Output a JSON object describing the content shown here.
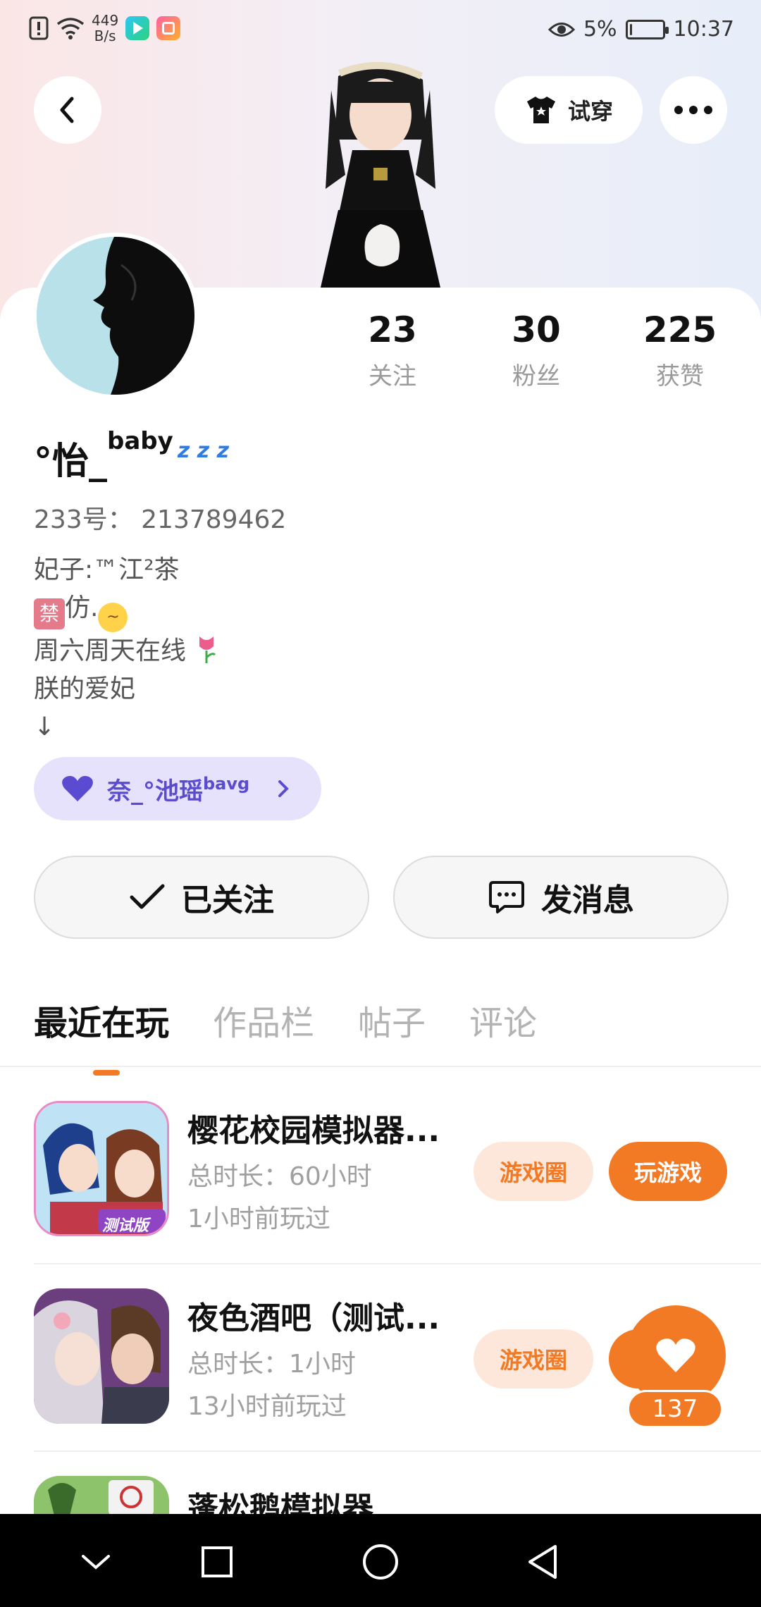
{
  "status_bar": {
    "net_speed_value": "449",
    "net_speed_unit": "B/s",
    "battery": "5%",
    "time": "10:37",
    "battery_level": 0.05
  },
  "header": {
    "try_on_label": "试穿"
  },
  "stats": [
    {
      "value": "23",
      "label": "关注"
    },
    {
      "value": "30",
      "label": "粉丝"
    },
    {
      "value": "225",
      "label": "获赞"
    }
  ],
  "profile": {
    "nickname_main": "°怡_",
    "nickname_sup": "baby",
    "nickname_zzz": "z z z",
    "id_line": "233号：  213789462",
    "bio": {
      "line1": "妃子:™江²茶",
      "line2_tag": "禁",
      "line2_text": "仿.",
      "line3": "周六周天在线",
      "line4": "朕的爱妃",
      "line5": "↓"
    },
    "couple_name": "奈_°池瑶",
    "couple_sup": "bavg"
  },
  "actions": {
    "follow_label": "已关注",
    "message_label": "发消息"
  },
  "tabs": [
    {
      "label": "最近在玩",
      "active": true
    },
    {
      "label": "作品栏",
      "active": false
    },
    {
      "label": "帖子",
      "active": false
    },
    {
      "label": "评论",
      "active": false
    }
  ],
  "games": [
    {
      "title": "樱花校园模拟器...",
      "duration": "总时长：60小时",
      "last_played": "1小时前玩过",
      "circle_label": "游戏圈",
      "play_label": "玩游戏",
      "icon_badge": "测试版"
    },
    {
      "title": "夜色酒吧（测试...",
      "duration": "总时长：1小时",
      "last_played": "13小时前玩过",
      "circle_label": "游戏圈"
    },
    {
      "title": "蓬松鹅模拟器"
    }
  ],
  "floating_like": {
    "count": "137"
  },
  "colors": {
    "accent": "#f37a25",
    "accent_light": "#fde7da",
    "couple_pill_bg": "#e7e2fb",
    "couple_pill_text": "#5a4bd1"
  }
}
